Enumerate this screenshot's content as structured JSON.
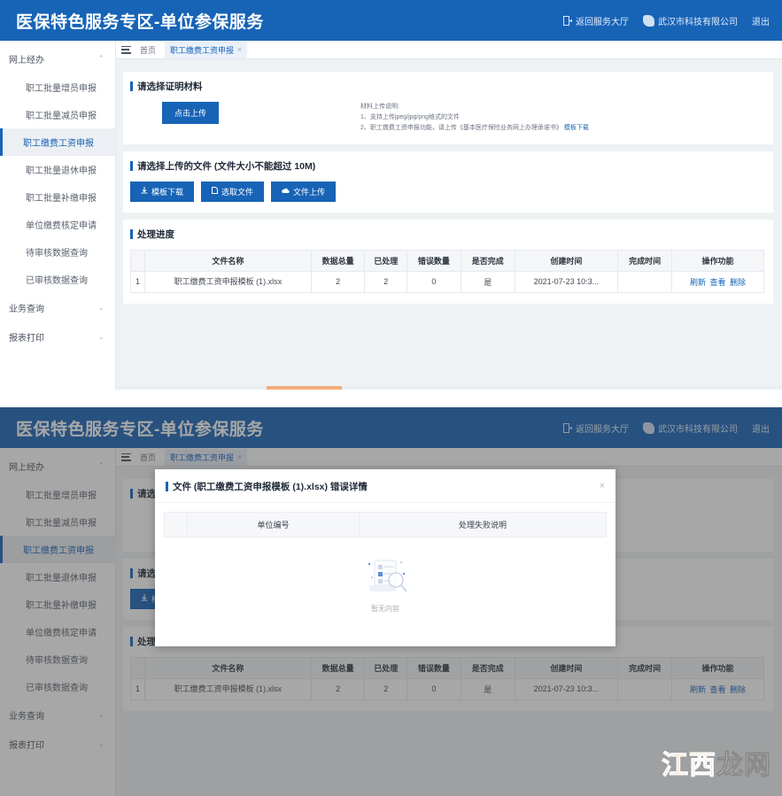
{
  "header": {
    "brand": "医保特色服务专区-单位参保服务",
    "return_label": "返回服务大厅",
    "company": "武汉市科技有限公司",
    "logout": "退出",
    "return_icon": "door-exit-icon",
    "avatar_icon": "user-avatar-icon"
  },
  "sidebar": {
    "group_online": "网上经办",
    "items": [
      "职工批量增员申报",
      "职工批量减员申报",
      "职工缴费工资申报",
      "职工批量退休申报",
      "职工批量补缴申报",
      "单位缴费核定申请",
      "待审核数据查询",
      "已审核数据查询"
    ],
    "active_index": 2,
    "group_query": "业务查询",
    "group_print": "报表打印"
  },
  "tabs": {
    "menu_icon": "hamburger-menu-icon",
    "home": "首页",
    "active": "职工缴费工资申报",
    "close": "×"
  },
  "section_material": {
    "title": "请选择证明材料",
    "upload_button": "点击上传",
    "note_title": "材料上传说明:",
    "note_1": "1、支持上传jpeg/jpg/png格式的文件",
    "note_2": "2、职工缴费工资申报功能，请上传《基本医疗保险业务网上办理承诺书》",
    "note_2_link": "模板下载"
  },
  "section_file": {
    "title": "请选择上传的文件 (文件大小不能超过 10M)",
    "buttons": [
      {
        "label": "模板下载",
        "icon": "download-icon"
      },
      {
        "label": "选取文件",
        "icon": "file-icon"
      },
      {
        "label": "文件上传",
        "icon": "cloud-upload-icon"
      }
    ]
  },
  "section_progress": {
    "title": "处理进度",
    "columns": [
      "",
      "文件名称",
      "数据总量",
      "已处理",
      "错误数量",
      "是否完成",
      "创建时间",
      "完成时间",
      "操作功能"
    ],
    "rows": [
      {
        "index": "1",
        "file_name": "职工缴费工资申报模板 (1).xlsx",
        "total": "2",
        "processed": "2",
        "errors": "0",
        "finished": "是",
        "created": "2021-07-23 10:3...",
        "completed": "",
        "ops": [
          "刷新",
          "查看",
          "删除"
        ]
      }
    ]
  },
  "modal": {
    "title": "文件 (职工缴费工资申报模板 (1).xlsx) 错误详情",
    "close": "×",
    "columns": [
      "",
      "单位编号",
      "处理失败说明"
    ],
    "empty_text": "暂无内容",
    "empty_icon": "document-search-empty-icon"
  },
  "watermark": {
    "part_a": "江西",
    "part_b": "龙网"
  },
  "colors": {
    "brand_blue": "#1763b6",
    "header_blue": "#1763b6",
    "arrow_red": "#ec2d21",
    "watermark_orange": "#ef8b1f"
  }
}
